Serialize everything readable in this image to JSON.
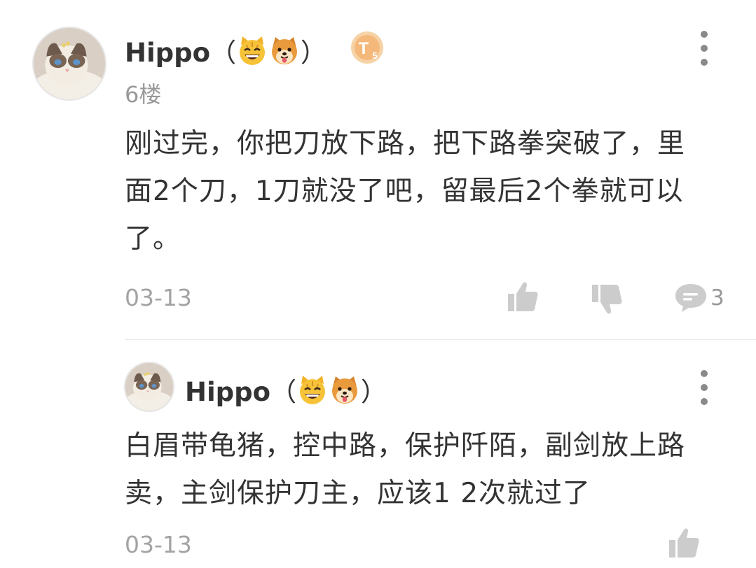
{
  "comment": {
    "username": "Hippo",
    "paren_open": "（",
    "paren_close": "）",
    "emojis": [
      "cat-face-emoji",
      "dog-face-emoji"
    ],
    "level_badge": "T5",
    "level_letter": "T",
    "level_number": "5",
    "floor": "6楼",
    "lines": [
      "刚过完，你把刀放下路，把下路拳突破了，里",
      "面2个刀，1刀就没了吧，留最后2个拳就可以",
      "了。"
    ],
    "time": "03-13",
    "reply_count": "3"
  },
  "reply": {
    "username": "Hippo",
    "paren_open": "（",
    "paren_close": "）",
    "lines": [
      "白眉带龟猪，控中路，保护阡陌，副剑放上路",
      "卖，主剑保护刀主，应该1 2次就过了"
    ],
    "time": "03-13"
  },
  "icons": {
    "like": "thumbs-up-icon",
    "dislike": "thumbs-down-icon",
    "reply": "chat-bubble-icon",
    "more": "more-vertical-icon"
  },
  "colors": {
    "text": "#333333",
    "meta": "#999999",
    "icon": "#cccccc",
    "badge": "#f0a864"
  }
}
